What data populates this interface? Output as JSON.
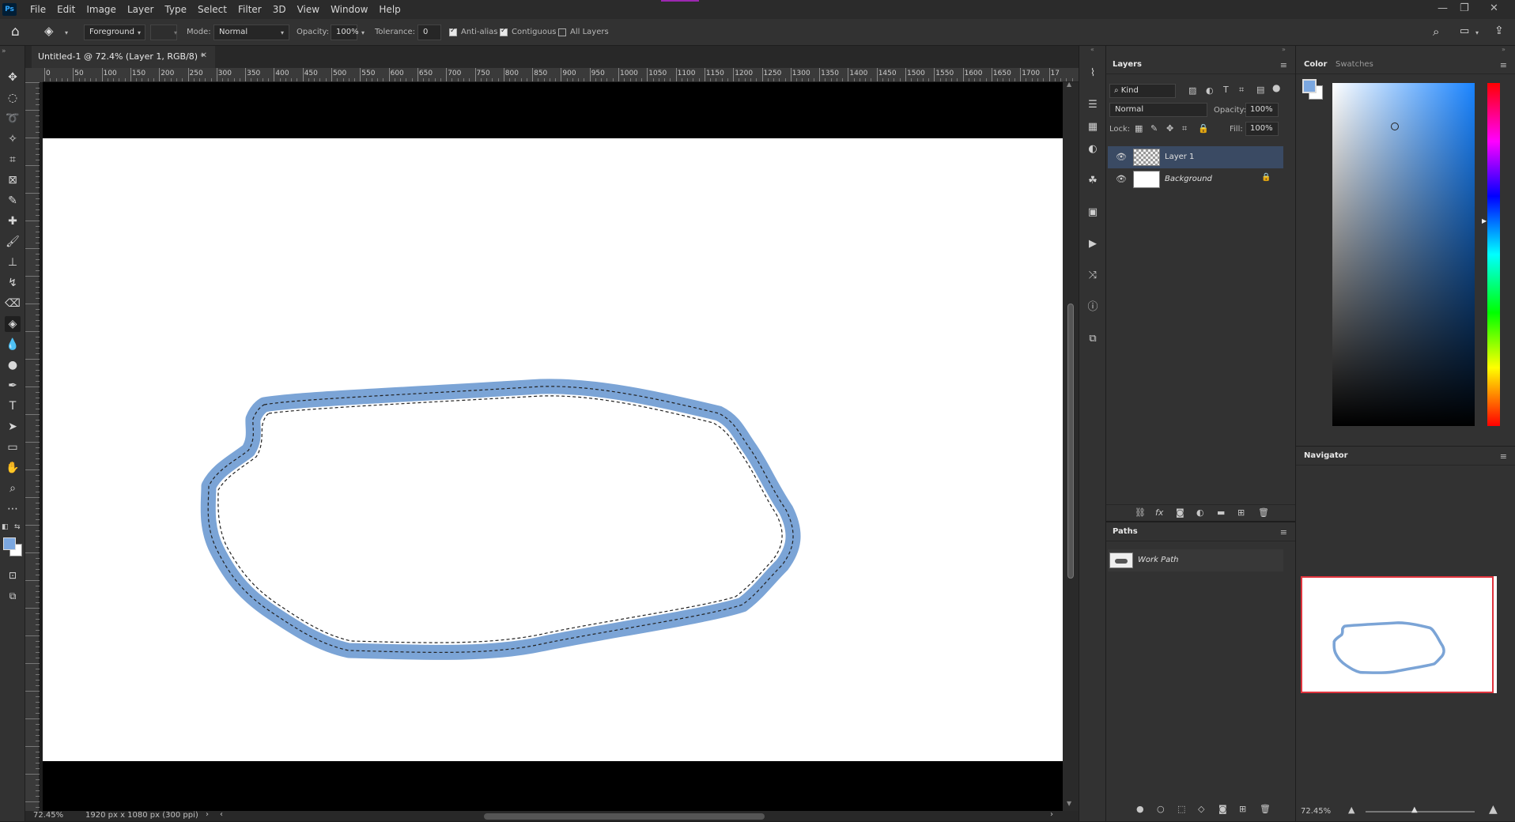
{
  "app": {
    "logo": "Ps"
  },
  "menu": [
    "File",
    "Edit",
    "Image",
    "Layer",
    "Type",
    "Select",
    "Filter",
    "3D",
    "View",
    "Window",
    "Help"
  ],
  "options": {
    "fill_source": "Foreground",
    "mode_label": "Mode:",
    "mode_value": "Normal",
    "opacity_label": "Opacity:",
    "opacity_value": "100%",
    "tolerance_label": "Tolerance:",
    "tolerance_value": "0",
    "antialias_label": "Anti-alias",
    "antialias": true,
    "contiguous_label": "Contiguous",
    "contiguous": true,
    "all_layers_label": "All Layers",
    "all_layers": false
  },
  "document": {
    "tab_title": "Untitled-1 @ 72.4% (Layer 1, RGB/8) *",
    "zoom": "72.45%",
    "info": "1920 px x 1080 px (300 ppi)"
  },
  "ruler": {
    "h_ticks": [
      "0",
      "50",
      "100",
      "150",
      "200",
      "250",
      "300",
      "350",
      "400",
      "450",
      "500",
      "550",
      "600",
      "650",
      "700",
      "750",
      "800",
      "850",
      "900",
      "950",
      "1000",
      "1050",
      "1100",
      "1150",
      "1200",
      "1250",
      "1300",
      "1350",
      "1400",
      "1450",
      "1500",
      "1550",
      "1600",
      "1650",
      "1700",
      "17"
    ]
  },
  "layers_panel": {
    "tab": "Layers",
    "filter": "Kind",
    "blend_mode": "Normal",
    "opacity_label": "Opacity:",
    "opacity": "100%",
    "lock_label": "Lock:",
    "fill_label": "Fill:",
    "fill": "100%",
    "layers": [
      {
        "name": "Layer 1",
        "selected": true,
        "visible": true
      },
      {
        "name": "Background",
        "selected": false,
        "visible": true,
        "locked": true
      }
    ]
  },
  "paths_panel": {
    "tab": "Paths",
    "paths": [
      {
        "name": "Work Path"
      }
    ]
  },
  "color_panel": {
    "tabs": [
      "Color",
      "Swatches"
    ],
    "foreground": "#7ba7e0",
    "background": "#ffffff"
  },
  "navigator": {
    "tab": "Navigator",
    "zoom": "72.45%"
  },
  "colors": {
    "stroke": "#7ba4d6",
    "selection_row": "#3a4a63",
    "nav_frame": "#e0343e"
  }
}
